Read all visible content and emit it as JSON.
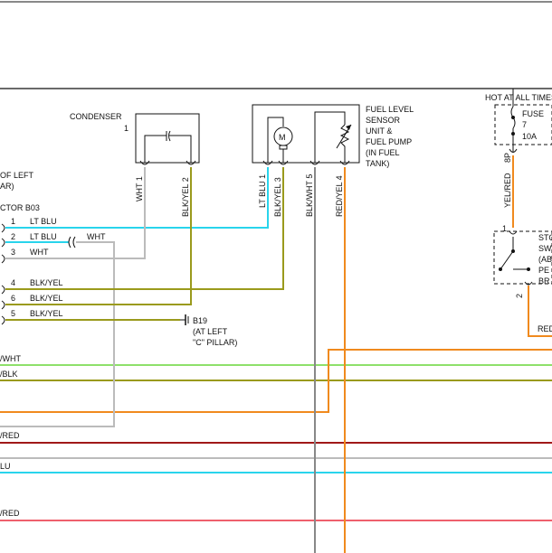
{
  "header": {
    "hot_at_all_times": "HOT AT ALL TIMES"
  },
  "components": {
    "condenser": {
      "name": "CONDENSER",
      "number": "1"
    },
    "fuel_sensor": {
      "lines": [
        "FUEL LEVEL",
        "SENSOR",
        "UNIT &",
        "FUEL PUMP",
        "(IN FUEL",
        "TANK)"
      ],
      "motor_symbol": "M"
    },
    "fuse": {
      "label": "FUSE",
      "number": "7",
      "rating": "10A"
    },
    "left_partial": {
      "line1": "OF LEFT",
      "line2": "AR)"
    },
    "connector": {
      "label": "CTOR B03"
    },
    "stop_switch": {
      "lines": [
        "STO",
        "SW",
        "(AB",
        "PE",
        "BR"
      ]
    },
    "ground": {
      "id": "B19",
      "line1": "(AT LEFT",
      "line2": "\"C\" PILLAR)"
    }
  },
  "connector_pins": [
    {
      "num": "1",
      "color": "LT BLU"
    },
    {
      "num": "2",
      "color": "LT BLU"
    },
    {
      "num": "3",
      "color": "WHT"
    },
    {
      "num": "4",
      "color": "BLK/YEL"
    },
    {
      "num": "6",
      "color": "BLK/YEL"
    },
    {
      "num": "5",
      "color": "BLK/YEL"
    }
  ],
  "splice_wire_label": "WHT",
  "vertical_labels": {
    "condenser_pin1": "WHT 1",
    "condenser_pin2": "BLK/YEL 2",
    "sensor_pin1": "LT BLU 1",
    "sensor_pin3": "BLK/YEL 3",
    "sensor_pin5": "BLK/WHT 5",
    "sensor_pin4": "RED/YEL 4",
    "fuse_out": "YEL/RED",
    "fuse_pin": "8P"
  },
  "switch_pins": {
    "top": "1",
    "bottom": "2"
  },
  "right_wire_label": "RED",
  "left_wire_labels": [
    "/WHT",
    "/BLK",
    "/RED",
    "LU",
    "/RED"
  ],
  "colors": {
    "lt_blu": "#29d4ec",
    "wht": "#bbbbbb",
    "blk_yel": "#9a9a1c",
    "orange": "#f08a1e",
    "green": "#8ee06a",
    "dark_red": "#a01818",
    "pink_red": "#ee5f6c",
    "gray": "#888888",
    "black": "#111111"
  }
}
